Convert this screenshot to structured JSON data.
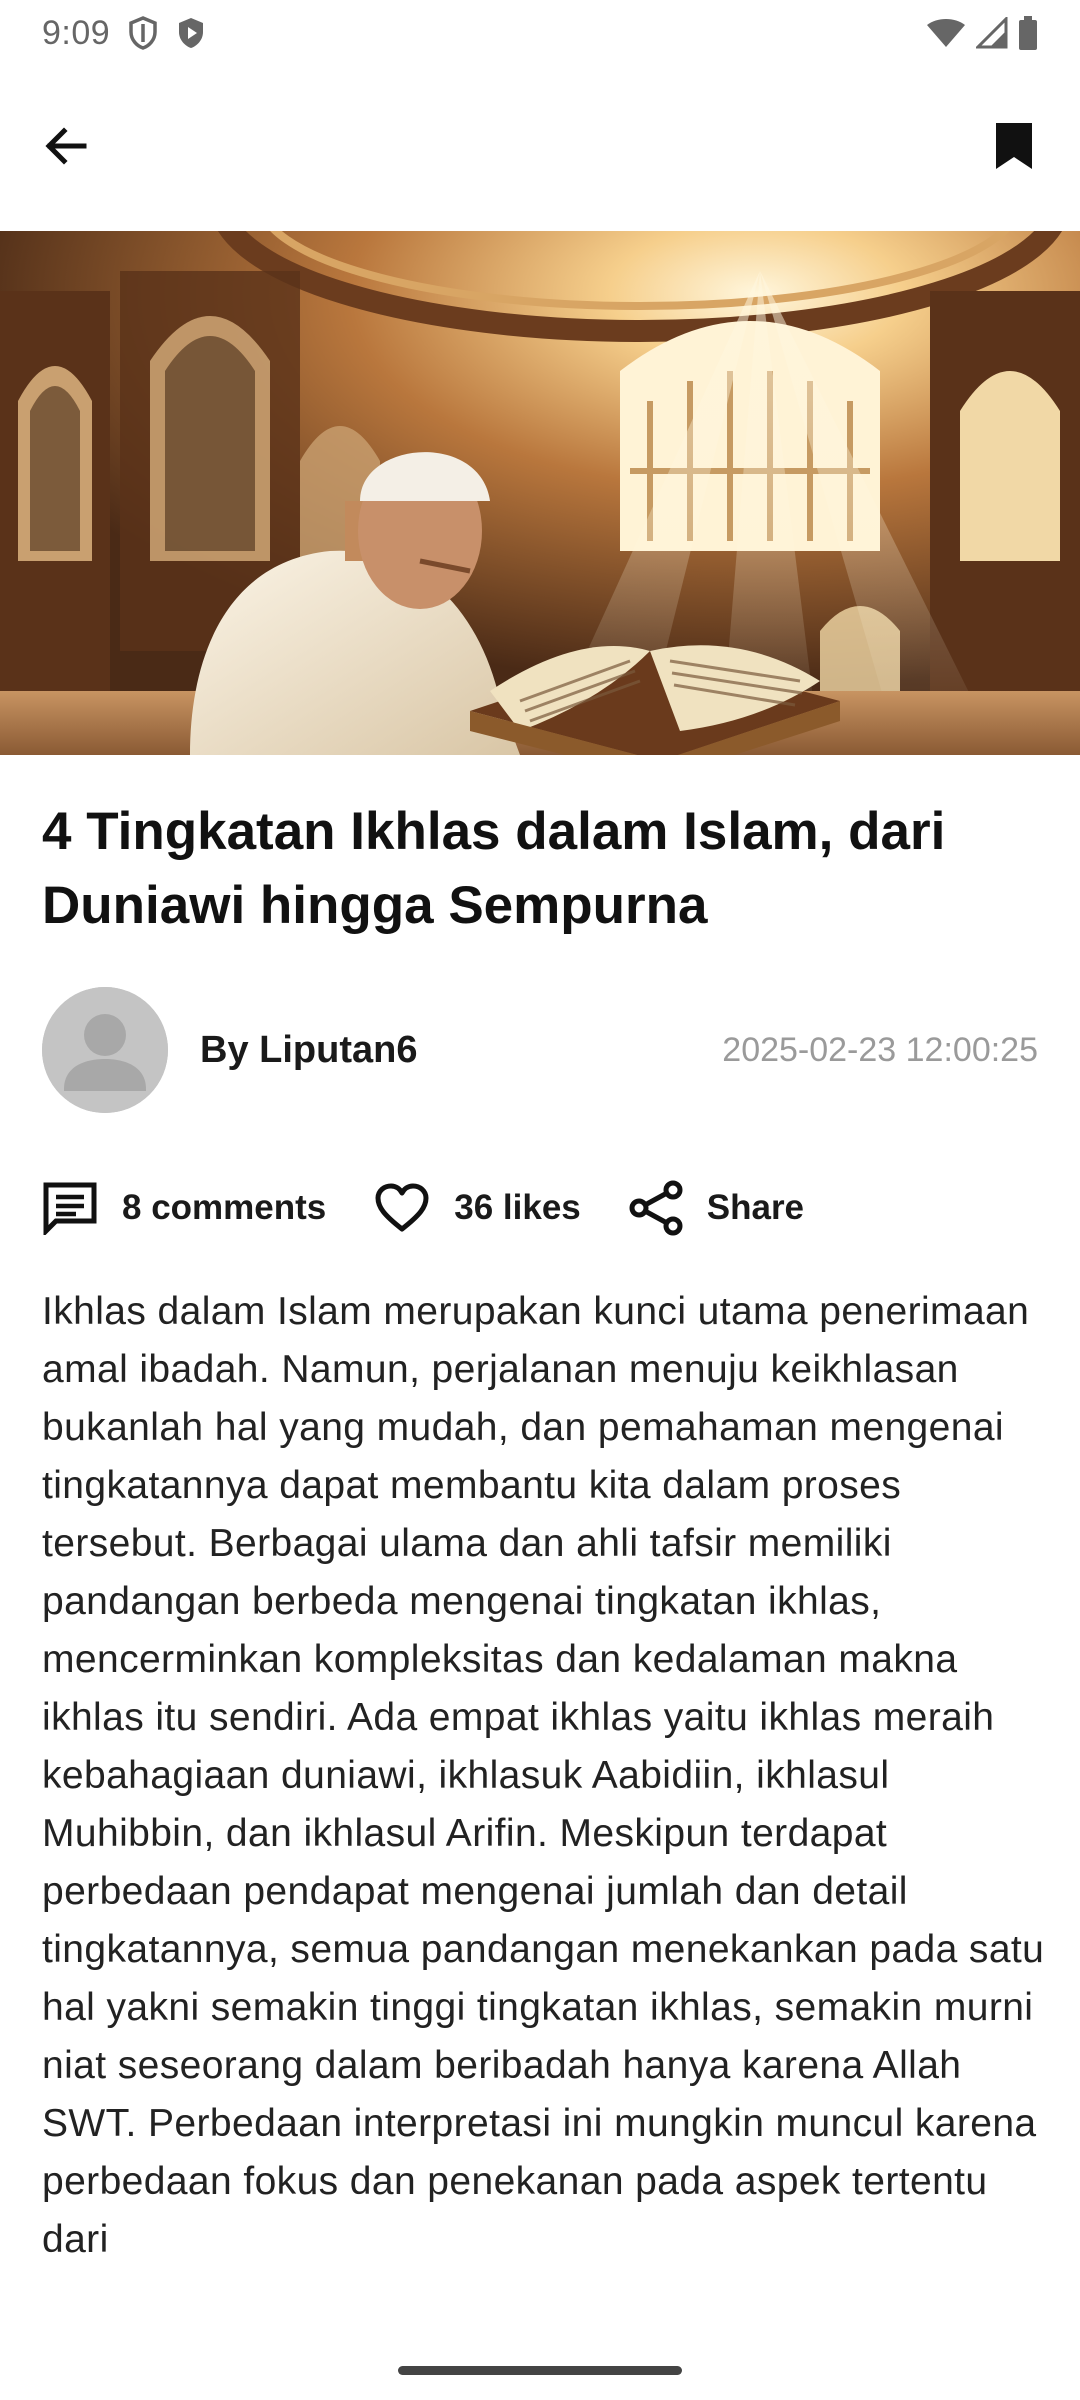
{
  "status_bar": {
    "time": "9:09",
    "icons": [
      "vpn-shield-icon",
      "play-protect-icon",
      "wifi-icon",
      "signal-icon",
      "battery-icon"
    ]
  },
  "app_bar": {
    "back_icon": "arrow-back-icon",
    "bookmark_icon": "bookmark-filled-icon"
  },
  "article": {
    "title": "4 Tingkatan Ikhlas dalam Islam, dari Duniawi hingga Sempurna",
    "author": "By Liputan6",
    "published": "2025-02-23 12:00:25",
    "body": "Ikhlas dalam Islam merupakan kunci utama penerimaan amal ibadah. Namun, perjalanan menuju keikhlasan bukanlah hal yang mudah, dan pemahaman mengenai tingkatannya dapat membantu kita dalam proses tersebut. Berbagai ulama dan ahli tafsir memiliki pandangan berbeda mengenai tingkatan ikhlas, mencerminkan kompleksitas dan kedalaman makna ikhlas itu sendiri. Ada empat ikhlas yaitu ikhlas meraih kebahagiaan duniawi, ikhlasuk Aabidiin, ikhlasul Muhibbin, dan ikhlasul Arifin. Meskipun terdapat perbedaan pendapat mengenai jumlah dan detail tingkatannya, semua pandangan menekankan pada satu hal yakni semakin tinggi tingkatan ikhlas, semakin murni niat seseorang dalam beribadah hanya karena Allah SWT. Perbedaan interpretasi ini mungkin muncul karena perbedaan fokus dan penekanan pada aspek tertentu dari"
  },
  "actions": {
    "comments_label": "8 comments",
    "likes_label": "36 likes",
    "share_label": "Share"
  }
}
